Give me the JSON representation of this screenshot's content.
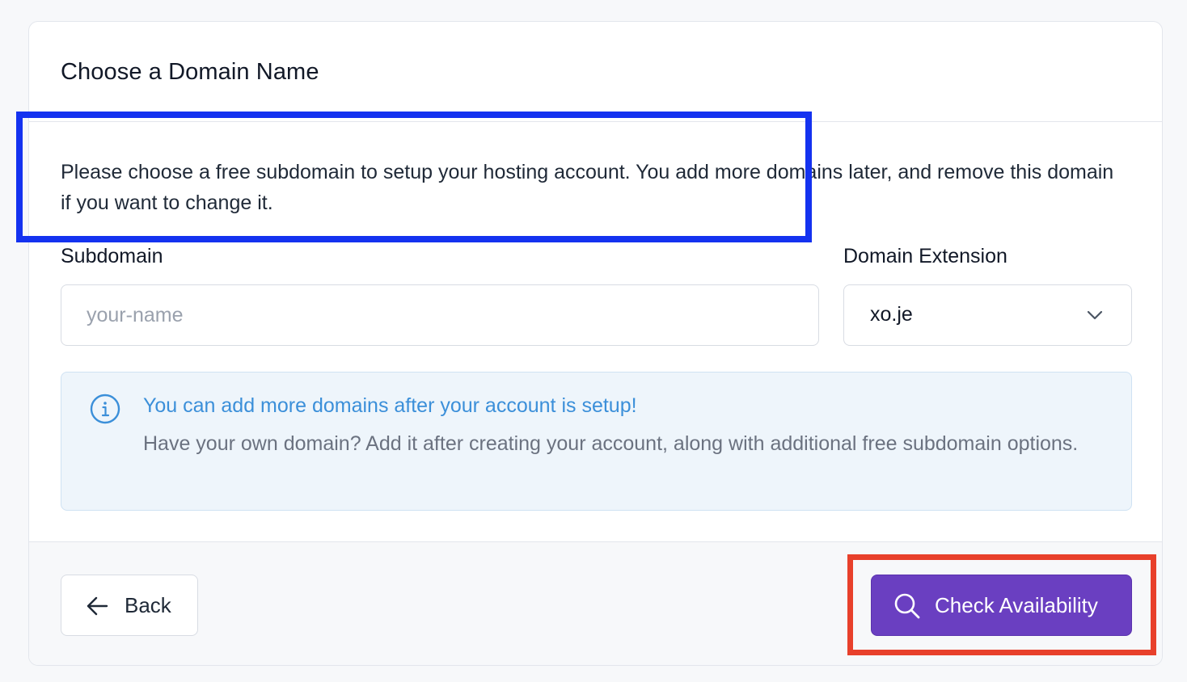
{
  "card": {
    "title": "Choose a Domain Name"
  },
  "body": {
    "intro": "Please choose a free subdomain to setup your hosting account. You add more domains later, and remove this domain if you want to change it.",
    "subdomain": {
      "label": "Subdomain",
      "placeholder": "your-name",
      "value": ""
    },
    "extension": {
      "label": "Domain Extension",
      "selected": "xo.je",
      "icon": "chevron-down-icon"
    },
    "info": {
      "icon": "info-icon",
      "title": "You can add more domains after your account is setup!",
      "text": "Have your own domain? Add it after creating your account, along with additional free subdomain options."
    }
  },
  "footer": {
    "back_label": "Back",
    "back_icon": "arrow-left-icon",
    "check_label": "Check Availability",
    "check_icon": "search-icon"
  },
  "colors": {
    "primary_button": "#6a3fc1",
    "info_title": "#3b8fd9",
    "info_background": "#eef5fb",
    "highlight_input": "#1432f0",
    "highlight_button": "#e8402b"
  }
}
